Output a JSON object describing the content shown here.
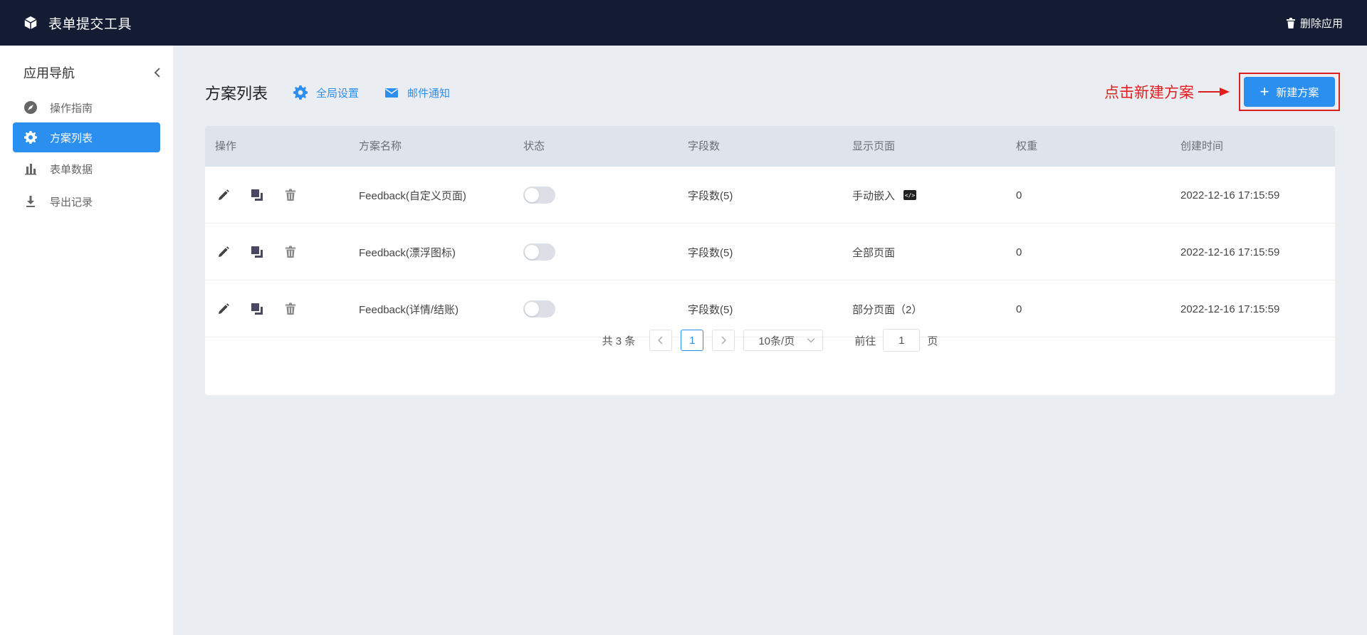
{
  "topbar": {
    "app_title": "表单提交工具",
    "logo_icon": "cube-icon",
    "delete_app_label": "删除应用",
    "delete_icon": "trash-icon",
    "background": "#141c33"
  },
  "sidebar": {
    "title": "应用导航",
    "items": [
      {
        "label": "操作指南",
        "icon": "compass-icon",
        "active": false
      },
      {
        "label": "方案列表",
        "icon": "gear-icon",
        "active": true
      },
      {
        "label": "表单数据",
        "icon": "bar-chart-icon",
        "active": false
      },
      {
        "label": "导出记录",
        "icon": "download-icon",
        "active": false
      }
    ]
  },
  "main": {
    "page_title": "方案列表",
    "links": {
      "global_settings": "全局设置",
      "email_notify": "邮件通知"
    },
    "annotation": "点击新建方案",
    "new_button": "新建方案",
    "accent_color": "#2b8ff0",
    "annotation_color": "#e02020"
  },
  "table": {
    "headers": [
      "操作",
      "方案名称",
      "状态",
      "字段数",
      "显示页面",
      "权重",
      "创建时间"
    ],
    "rows": [
      {
        "name": "Feedback(自定义页面)",
        "status": false,
        "fields": "字段数(5)",
        "pages": "手动嵌入",
        "weight": "0",
        "created": "2022-12-16 17:15:59"
      },
      {
        "name": "Feedback(漂浮图标)",
        "status": false,
        "fields": "字段数(5)",
        "pages": "全部页面",
        "weight": "0",
        "created": "2022-12-16 17:15:59"
      },
      {
        "name": "Feedback(详情/结账)",
        "status": false,
        "fields": "字段数(5)",
        "pages": "部分页面（2）",
        "weight": "0",
        "created": "2022-12-16 17:15:59"
      }
    ]
  },
  "pagination": {
    "total": "共 3 条",
    "current_page": "1",
    "page_size": "10条/页",
    "goto_label": "前往",
    "goto_value": "1",
    "page_suffix": "页"
  }
}
